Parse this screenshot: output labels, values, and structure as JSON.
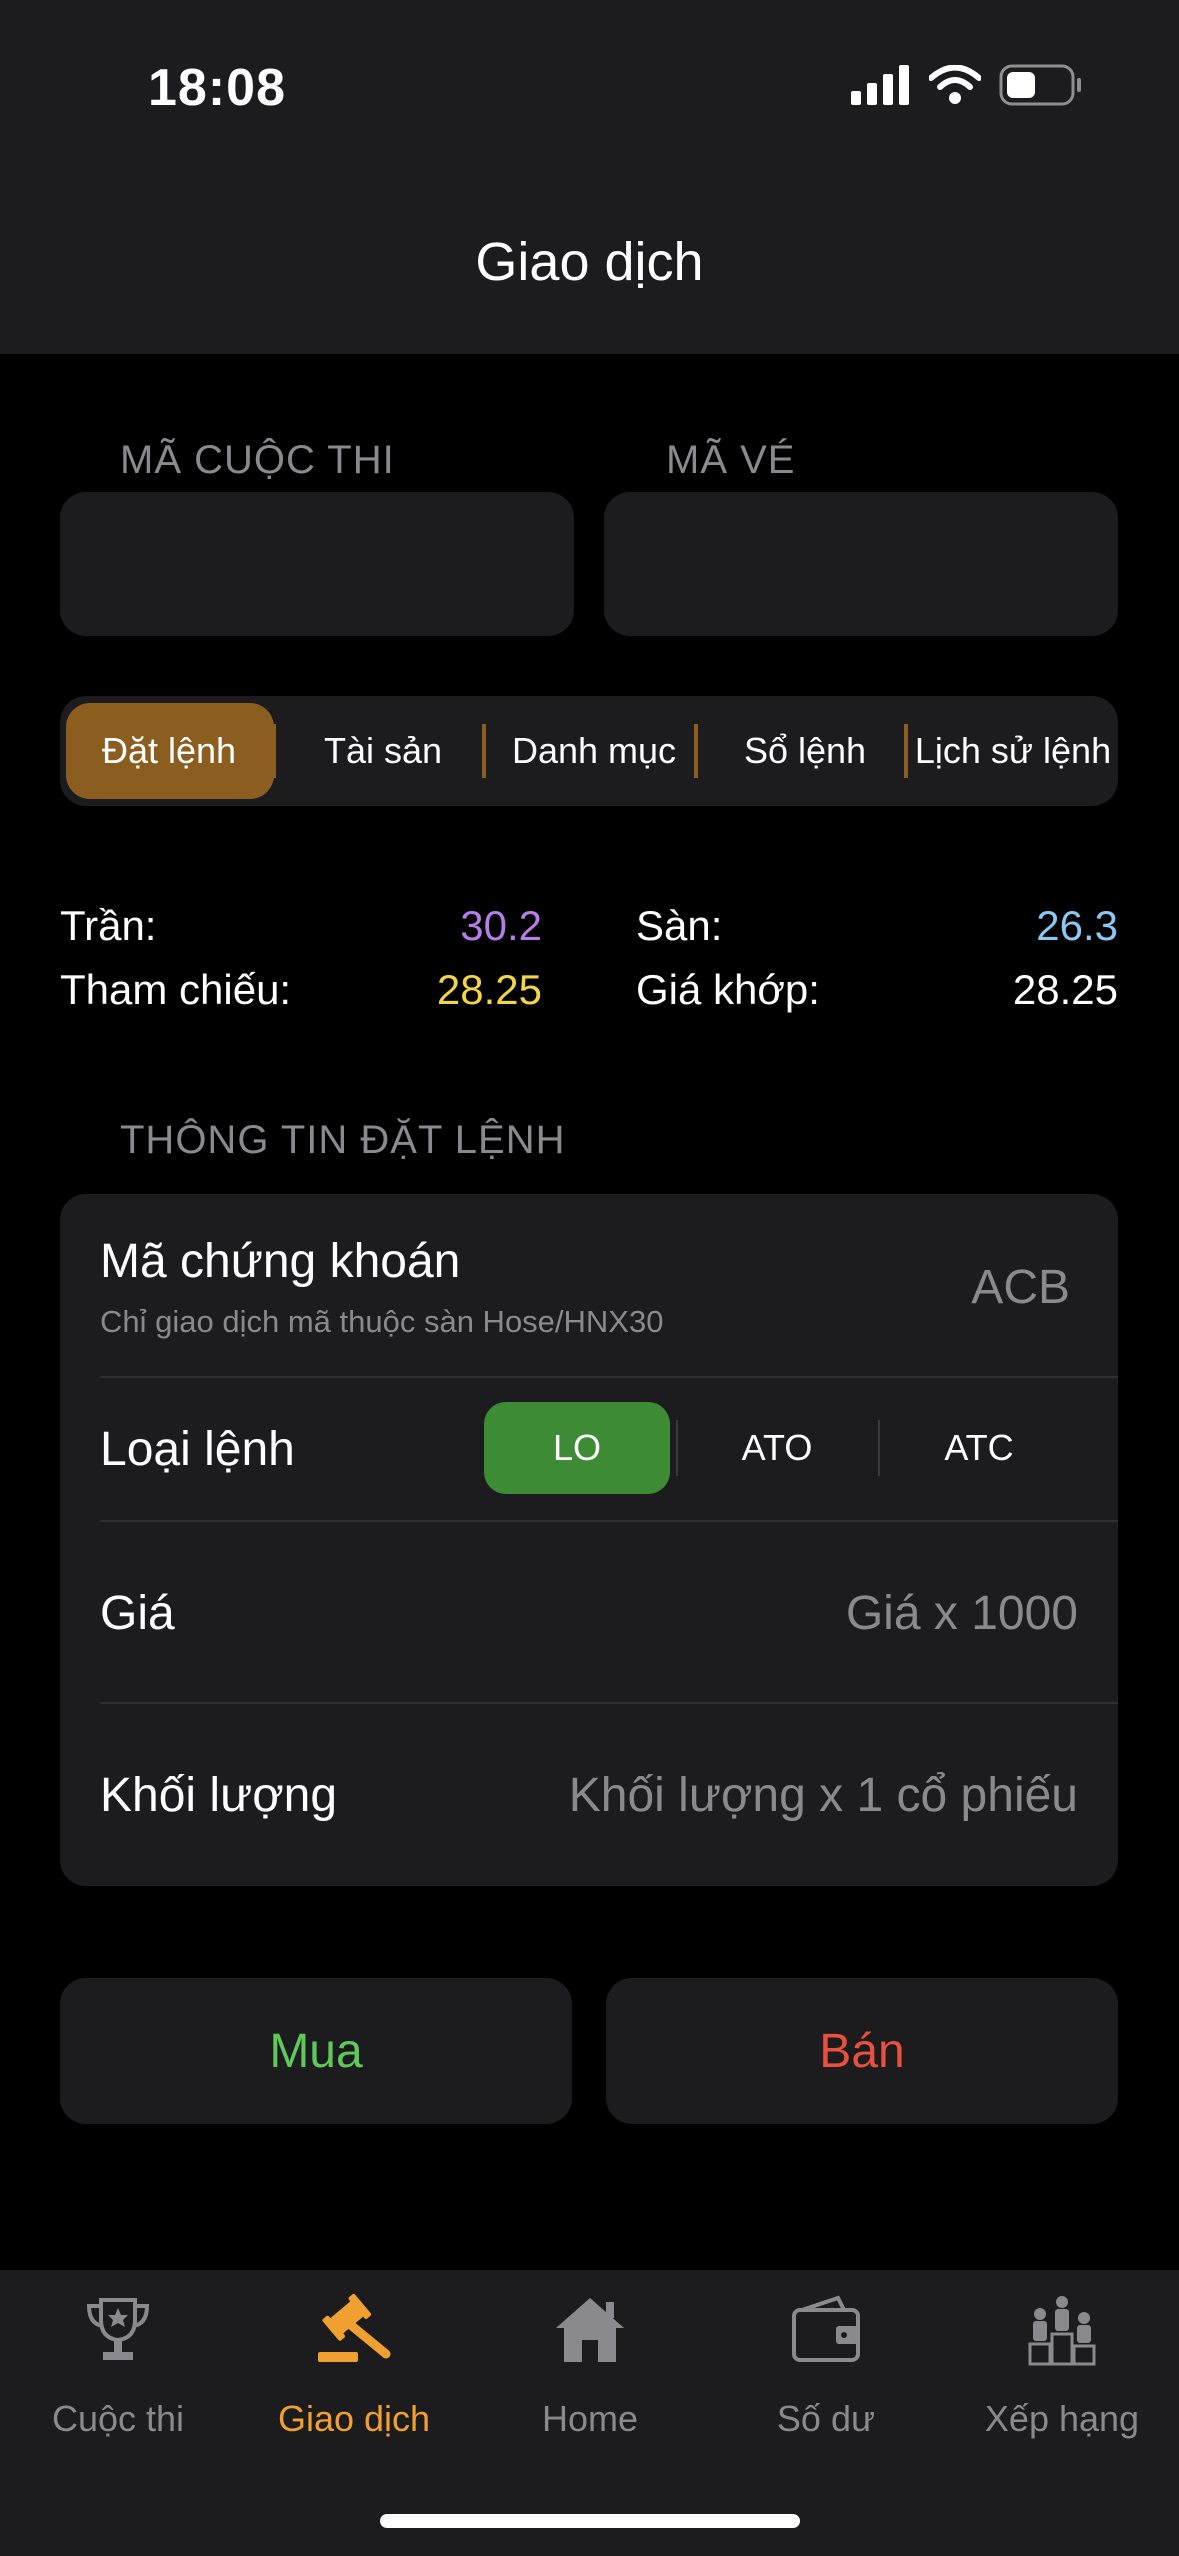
{
  "status": {
    "time": "18:08",
    "battery_icon": "battery-icon",
    "wifi_icon": "wifi-icon",
    "signal_icon": "signal-icon"
  },
  "header": {
    "title": "Giao dịch"
  },
  "form": {
    "contest_code_label": "MÃ CUỘC THI",
    "contest_code_value": "",
    "ticket_code_label": "MÃ VÉ",
    "ticket_code_value": ""
  },
  "tabs": [
    {
      "label": "Đặt lệnh",
      "active": true
    },
    {
      "label": "Tài sản",
      "active": false
    },
    {
      "label": "Danh mục",
      "active": false
    },
    {
      "label": "Sổ lệnh",
      "active": false
    },
    {
      "label": "Lịch sử lệnh",
      "active": false
    }
  ],
  "prices": {
    "ceiling_label": "Trần:",
    "ceiling_value": "30.2",
    "ceiling_color": "#b57ee8",
    "floor_label": "Sàn:",
    "floor_value": "26.3",
    "floor_color": "#8cc8f0",
    "ref_label": "Tham chiếu:",
    "ref_value": "28.25",
    "ref_color": "#f2d445",
    "match_label": "Giá khớp:",
    "match_value": "28.25",
    "match_color": "#ffffff"
  },
  "order": {
    "section_title": "THÔNG TIN ĐẶT LỆNH",
    "symbol_label": "Mã chứng khoán",
    "symbol_hint": "Chỉ giao dịch mã thuộc sàn Hose/HNX30",
    "symbol_value": "ACB",
    "type_label": "Loại lệnh",
    "types": [
      {
        "label": "LO",
        "active": true
      },
      {
        "label": "ATO",
        "active": false
      },
      {
        "label": "ATC",
        "active": false
      }
    ],
    "price_label": "Giá",
    "price_placeholder": "Giá x 1000",
    "qty_label": "Khối lượng",
    "qty_placeholder": "Khối lượng x 1 cổ phiếu"
  },
  "actions": {
    "buy_label": "Mua",
    "buy_color": "#5ec95a",
    "sell_label": "Bán",
    "sell_color": "#e8503f"
  },
  "tabbar": [
    {
      "label": "Cuộc thi",
      "icon": "trophy-icon",
      "active": false
    },
    {
      "label": "Giao dịch",
      "icon": "gavel-icon",
      "active": true
    },
    {
      "label": "Home",
      "icon": "home-icon",
      "active": false
    },
    {
      "label": "Số dư",
      "icon": "wallet-icon",
      "active": false
    },
    {
      "label": "Xếp hạng",
      "icon": "leaderboard-icon",
      "active": false
    }
  ],
  "accent_color": "#f0a030"
}
